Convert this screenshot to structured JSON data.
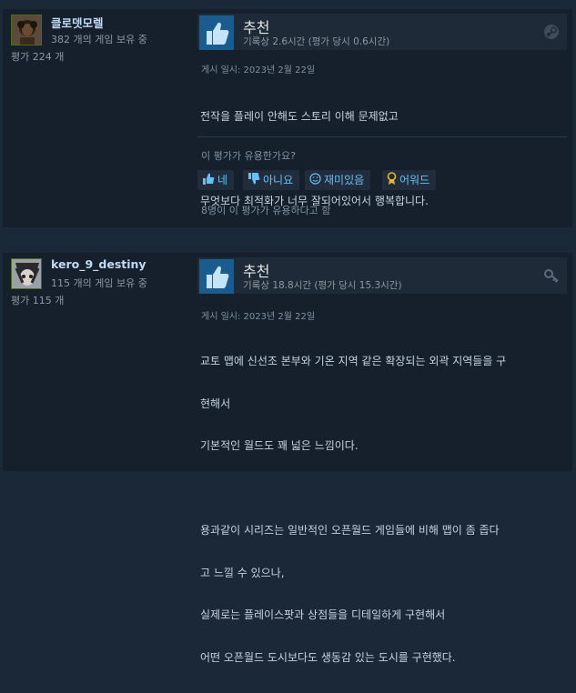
{
  "reviews": [
    {
      "author": {
        "name": "클로뎃모렐",
        "games": "382 개의 게임 보유 중",
        "reviews": "평가 224 개"
      },
      "verdict": "추천",
      "hours": "기록상 2.6시간 (평가 당시 0.6시간)",
      "corner_icon": "steam-icon",
      "posted": "게시 일시: 2023년 2월 22일",
      "content_lines": [
        "전작을 플레이 안해도 스토리 이해 문제없고",
        "",
        "무엇보다 최적화가 너무 잘되어있어서 행복합니다."
      ],
      "question": "이 평가가 유용한가요?",
      "buttons": {
        "yes": "네",
        "no": "아니요",
        "funny": "재미있음",
        "award": "어워드"
      },
      "helpful": "8명이 이 평가가 유용하다고 함"
    },
    {
      "author": {
        "name": "kero_9_destiny",
        "games": "115 개의 게임 보유 중",
        "reviews": "평가 115 개"
      },
      "verdict": "추천",
      "hours": "기록상 18.8시간 (평가 당시 15.3시간)",
      "corner_icon": "key-icon",
      "posted": "게시 일시: 2023년 2월 22일",
      "content_lines": [
        "교토 맵에 신선조 본부와 기온 지역 같은 확장되는 외곽 지역들을 구",
        "현해서",
        "기본적인 월드도 꽤 넓은 느낌이다.",
        "",
        "용과같이 시리즈는 일반적인 오픈월드 게임들에 비해 맵이 좀 좁다",
        "고 느낄 수 있으나,",
        "실제로는 플레이스팟과 상점들을 디테일하게 구현해서",
        "어떤 오픈월드 도시보다도 생동감 있는 도시를 구현했다."
      ]
    }
  ],
  "colors": {
    "page_bg": "#1b2838",
    "card_bg": "#16202d",
    "link": "#66c0f4",
    "thumb_bg": "#1a5c8e"
  }
}
